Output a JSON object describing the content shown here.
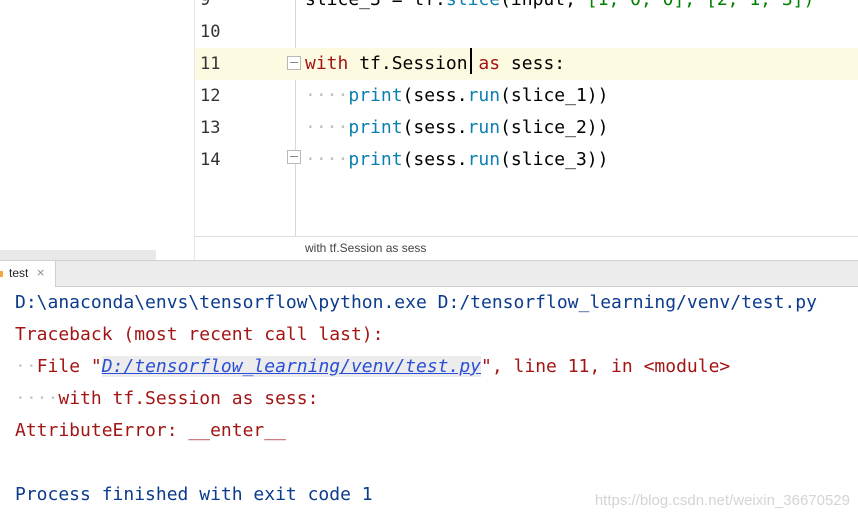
{
  "editor": {
    "partial_line": {
      "number": "9",
      "segments": [
        {
          "text": "slice_3",
          "cls": "sym"
        },
        {
          "text": " = ",
          "cls": "sym"
        },
        {
          "text": "tf.",
          "cls": "sym"
        },
        {
          "text": "slice",
          "cls": "fn"
        },
        {
          "text": "(input,",
          "cls": "sym"
        },
        {
          "text": " [1, 0, 0], [2, 1, 3])",
          "cls": "paren"
        }
      ]
    },
    "lines": [
      {
        "number": "10",
        "segments": []
      },
      {
        "number": "11",
        "segments": [
          {
            "text": "with",
            "cls": "kw2"
          },
          {
            "text": " tf.Session",
            "cls": "sym"
          },
          {
            "text": " as",
            "cls": "kw2"
          },
          {
            "text": " sess:",
            "cls": "sym"
          }
        ]
      },
      {
        "number": "12",
        "segments": [
          {
            "text": "····",
            "cls": "dot"
          },
          {
            "text": "print",
            "cls": "bi"
          },
          {
            "text": "(sess.",
            "cls": "sym"
          },
          {
            "text": "run",
            "cls": "fn"
          },
          {
            "text": "(slice_1))",
            "cls": "sym"
          }
        ]
      },
      {
        "number": "13",
        "segments": [
          {
            "text": "····",
            "cls": "dot"
          },
          {
            "text": "print",
            "cls": "bi"
          },
          {
            "text": "(sess.",
            "cls": "sym"
          },
          {
            "text": "run",
            "cls": "fn"
          },
          {
            "text": "(slice_2))",
            "cls": "sym"
          }
        ]
      },
      {
        "number": "14",
        "segments": [
          {
            "text": "····",
            "cls": "dot"
          },
          {
            "text": "print",
            "cls": "bi"
          },
          {
            "text": "(sess.",
            "cls": "sym"
          },
          {
            "text": "run",
            "cls": "fn"
          },
          {
            "text": "(slice_3))",
            "cls": "sym"
          }
        ]
      }
    ],
    "breadcrumb": "with tf.Session as sess"
  },
  "run_panel": {
    "tab_label": "test",
    "tab_close": "×"
  },
  "console": {
    "command": "D:\\anaconda\\envs\\tensorflow\\python.exe D:/tensorflow_learning/venv/test.py",
    "traceback_header": "Traceback (most recent call last):",
    "file_prefix": "File \"",
    "file_link": "D:/tensorflow_learning/venv/test.py",
    "file_suffix": "\", line 11, in <module>",
    "source_line": "with tf.Session as sess:",
    "error": "AttributeError: __enter__",
    "exit_message": "Process finished with exit code 1"
  },
  "watermark": "https://blog.csdn.net/weixin_36670529"
}
